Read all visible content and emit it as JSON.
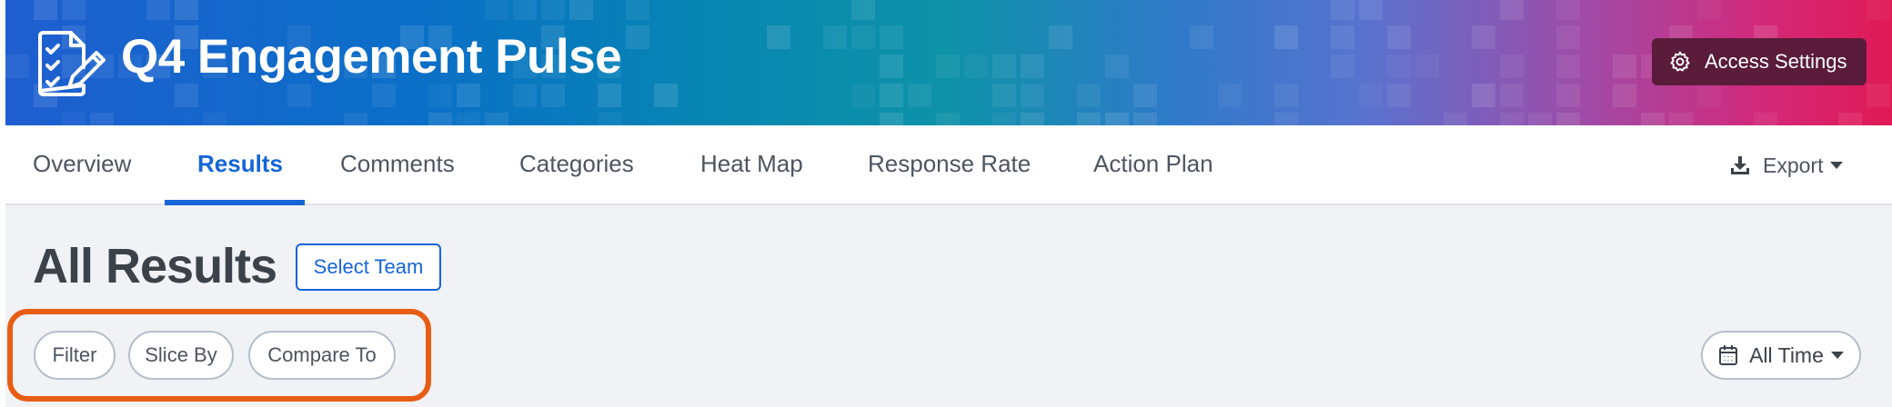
{
  "header": {
    "app_title": "Q4 Engagement Pulse",
    "logo_icon": "survey-checklist-icon",
    "access_settings_label": "Access Settings",
    "access_settings_icon": "gear-icon",
    "banner_colors": [
      "#1f5ed0",
      "#0787b1",
      "#5873cf",
      "#d2297a",
      "#e01a55"
    ]
  },
  "tabs": {
    "items": [
      {
        "label": "Overview"
      },
      {
        "label": "Results"
      },
      {
        "label": "Comments"
      },
      {
        "label": "Categories"
      },
      {
        "label": "Heat Map"
      },
      {
        "label": "Response Rate"
      },
      {
        "label": "Action Plan"
      }
    ],
    "active": "Results",
    "export_label": "Export",
    "export_icon": "download-icon"
  },
  "main": {
    "title": "All Results",
    "select_team_label": "Select Team",
    "filters": [
      {
        "label": "Filter"
      },
      {
        "label": "Slice By"
      },
      {
        "label": "Compare To"
      }
    ],
    "time_range_label": "All Time",
    "time_range_icon": "calendar-icon"
  },
  "colors": {
    "accent": "#1565d8",
    "highlight": "#e85d14",
    "access_button": "#5a1c3a"
  }
}
